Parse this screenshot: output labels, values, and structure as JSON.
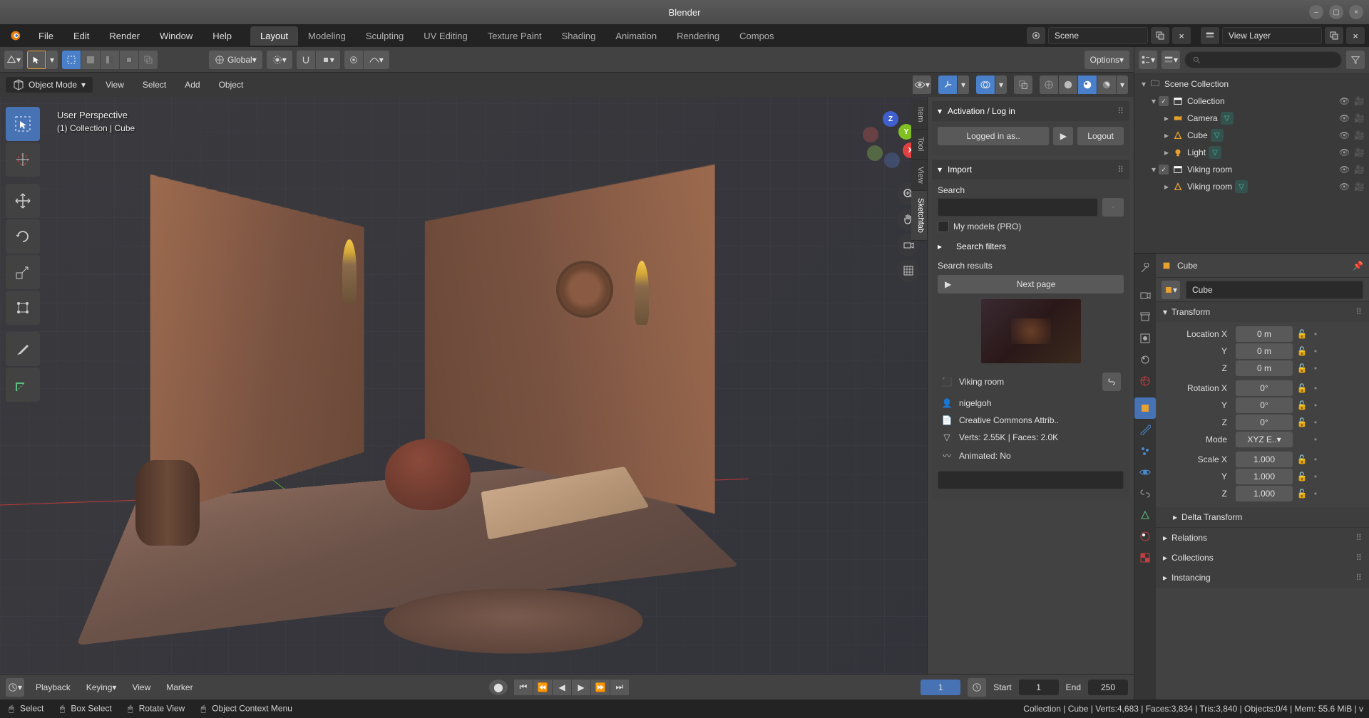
{
  "title": "Blender",
  "menu": [
    "File",
    "Edit",
    "Render",
    "Window",
    "Help"
  ],
  "workspaces": [
    "Layout",
    "Modeling",
    "Sculpting",
    "UV Editing",
    "Texture Paint",
    "Shading",
    "Animation",
    "Rendering",
    "Compos"
  ],
  "active_workspace": "Layout",
  "scene_name": "Scene",
  "view_layer": "View Layer",
  "viewport": {
    "orientation": "Global",
    "mode": "Object Mode",
    "sub_menu": [
      "View",
      "Select",
      "Add",
      "Object"
    ],
    "overlay_title": "User Perspective",
    "overlay_sub": "(1) Collection | Cube",
    "options": "Options"
  },
  "sketchfab": {
    "activation_header": "Activation / Log in",
    "logged_in": "Logged in as..",
    "logout": "Logout",
    "import_header": "Import",
    "search_label": "Search",
    "my_models": "My models (PRO)",
    "filters": "Search filters",
    "results_header": "Search results",
    "next_page": "Next page",
    "model_name": "Viking room",
    "author": "nigelgoh",
    "license": "Creative Commons Attrib..",
    "stats": "Verts: 2.55K  |  Faces: 2.0K",
    "animated": "Animated: No"
  },
  "side_tabs": [
    "Item",
    "Tool",
    "View",
    "Sketchfab"
  ],
  "outliner": {
    "root": "Scene Collection",
    "items": [
      {
        "name": "Collection",
        "type": "coll",
        "indent": 1,
        "checked": true,
        "exp": "▾"
      },
      {
        "name": "Camera",
        "type": "cam",
        "indent": 2,
        "exp": "▸",
        "badge": "teal"
      },
      {
        "name": "Cube",
        "type": "mesh",
        "indent": 2,
        "exp": "▸",
        "badge": "teal"
      },
      {
        "name": "Light",
        "type": "light",
        "indent": 2,
        "exp": "▸",
        "badge": "teal"
      },
      {
        "name": "Viking room",
        "type": "coll",
        "indent": 1,
        "checked": true,
        "exp": "▾"
      },
      {
        "name": "Viking room",
        "type": "mesh",
        "indent": 2,
        "exp": "▸",
        "badge": "teal"
      }
    ]
  },
  "properties": {
    "object_name": "Cube",
    "datablock": "Cube",
    "transform_header": "Transform",
    "location": {
      "label": "Location X",
      "x": "0 m",
      "y": "0 m",
      "z": "0 m"
    },
    "rotation": {
      "label": "Rotation X",
      "x": "0°",
      "y": "0°",
      "z": "0°"
    },
    "mode": {
      "label": "Mode",
      "value": "XYZ E..▾"
    },
    "scale": {
      "label": "Scale X",
      "x": "1.000",
      "y": "1.000",
      "z": "1.000"
    },
    "sections": [
      "Delta Transform",
      "Relations",
      "Collections",
      "Instancing"
    ]
  },
  "timeline": {
    "menus": [
      "Playback",
      "Keying",
      "View",
      "Marker"
    ],
    "current": "1",
    "start_label": "Start",
    "start": "1",
    "end_label": "End",
    "end": "250"
  },
  "statusbar": {
    "select": "Select",
    "box_select": "Box Select",
    "rotate_view": "Rotate View",
    "context_menu": "Object Context Menu",
    "stats": "Collection | Cube | Verts:4,683 | Faces:3,834 | Tris:3,840 | Objects:0/4 | Mem: 55.6 MiB | v"
  }
}
